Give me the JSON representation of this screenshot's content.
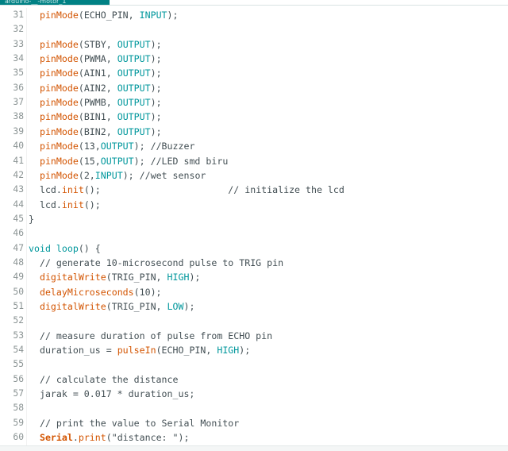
{
  "tab": {
    "label": "arduino-__-motor_1"
  },
  "colors": {
    "accent": "#008184",
    "function": "#d35400",
    "constant": "#00979c",
    "text": "#434f54",
    "line_number": "#8a9393"
  },
  "lines": [
    {
      "n": "31",
      "fold": "",
      "tokens": [
        {
          "t": "  "
        },
        {
          "t": "pinMode",
          "c": "fn"
        },
        {
          "t": "(ECHO_PIN, "
        },
        {
          "t": "INPUT",
          "c": "const"
        },
        {
          "t": ");"
        }
      ]
    },
    {
      "n": "32",
      "fold": "",
      "tokens": []
    },
    {
      "n": "33",
      "fold": "",
      "tokens": [
        {
          "t": "  "
        },
        {
          "t": "pinMode",
          "c": "fn"
        },
        {
          "t": "(STBY, "
        },
        {
          "t": "OUTPUT",
          "c": "const"
        },
        {
          "t": ");"
        }
      ]
    },
    {
      "n": "34",
      "fold": "",
      "tokens": [
        {
          "t": "  "
        },
        {
          "t": "pinMode",
          "c": "fn"
        },
        {
          "t": "(PWMA, "
        },
        {
          "t": "OUTPUT",
          "c": "const"
        },
        {
          "t": ");"
        }
      ]
    },
    {
      "n": "35",
      "fold": "",
      "tokens": [
        {
          "t": "  "
        },
        {
          "t": "pinMode",
          "c": "fn"
        },
        {
          "t": "(AIN1, "
        },
        {
          "t": "OUTPUT",
          "c": "const"
        },
        {
          "t": ");"
        }
      ]
    },
    {
      "n": "36",
      "fold": "",
      "tokens": [
        {
          "t": "  "
        },
        {
          "t": "pinMode",
          "c": "fn"
        },
        {
          "t": "(AIN2, "
        },
        {
          "t": "OUTPUT",
          "c": "const"
        },
        {
          "t": ");"
        }
      ]
    },
    {
      "n": "37",
      "fold": "",
      "tokens": [
        {
          "t": "  "
        },
        {
          "t": "pinMode",
          "c": "fn"
        },
        {
          "t": "(PWMB, "
        },
        {
          "t": "OUTPUT",
          "c": "const"
        },
        {
          "t": ");"
        }
      ]
    },
    {
      "n": "38",
      "fold": "",
      "tokens": [
        {
          "t": "  "
        },
        {
          "t": "pinMode",
          "c": "fn"
        },
        {
          "t": "(BIN1, "
        },
        {
          "t": "OUTPUT",
          "c": "const"
        },
        {
          "t": ");"
        }
      ]
    },
    {
      "n": "39",
      "fold": "",
      "tokens": [
        {
          "t": "  "
        },
        {
          "t": "pinMode",
          "c": "fn"
        },
        {
          "t": "(BIN2, "
        },
        {
          "t": "OUTPUT",
          "c": "const"
        },
        {
          "t": ");"
        }
      ]
    },
    {
      "n": "40",
      "fold": "",
      "tokens": [
        {
          "t": "  "
        },
        {
          "t": "pinMode",
          "c": "fn"
        },
        {
          "t": "(13,"
        },
        {
          "t": "OUTPUT",
          "c": "const"
        },
        {
          "t": "); //Buzzer"
        }
      ]
    },
    {
      "n": "41",
      "fold": "",
      "tokens": [
        {
          "t": "  "
        },
        {
          "t": "pinMode",
          "c": "fn"
        },
        {
          "t": "(15,"
        },
        {
          "t": "OUTPUT",
          "c": "const"
        },
        {
          "t": "); //LED smd biru"
        }
      ]
    },
    {
      "n": "42",
      "fold": "",
      "tokens": [
        {
          "t": "  "
        },
        {
          "t": "pinMode",
          "c": "fn"
        },
        {
          "t": "(2,"
        },
        {
          "t": "INPUT",
          "c": "const"
        },
        {
          "t": "); //wet sensor"
        }
      ]
    },
    {
      "n": "43",
      "fold": "",
      "tokens": [
        {
          "t": "  lcd."
        },
        {
          "t": "init",
          "c": "fn"
        },
        {
          "t": "();                       // initialize the lcd"
        }
      ]
    },
    {
      "n": "44",
      "fold": "",
      "tokens": [
        {
          "t": "  lcd."
        },
        {
          "t": "init",
          "c": "fn"
        },
        {
          "t": "();"
        }
      ]
    },
    {
      "n": "45",
      "fold": "",
      "tokens": [
        {
          "t": "}"
        }
      ]
    },
    {
      "n": "46",
      "fold": "",
      "tokens": []
    },
    {
      "n": "47",
      "fold": "",
      "tokens": [
        {
          "t": "void",
          "c": "kw"
        },
        {
          "t": " "
        },
        {
          "t": "loop",
          "c": "kw"
        },
        {
          "t": "() {"
        }
      ]
    },
    {
      "n": "48",
      "fold": "",
      "tokens": [
        {
          "t": "  // generate 10-microsecond pulse to TRIG pin"
        }
      ]
    },
    {
      "n": "49",
      "fold": "",
      "tokens": [
        {
          "t": "  "
        },
        {
          "t": "digitalWrite",
          "c": "fn"
        },
        {
          "t": "(TRIG_PIN, "
        },
        {
          "t": "HIGH",
          "c": "const"
        },
        {
          "t": ");"
        }
      ]
    },
    {
      "n": "50",
      "fold": "",
      "tokens": [
        {
          "t": "  "
        },
        {
          "t": "delayMicroseconds",
          "c": "fn"
        },
        {
          "t": "(10);"
        }
      ]
    },
    {
      "n": "51",
      "fold": "",
      "tokens": [
        {
          "t": "  "
        },
        {
          "t": "digitalWrite",
          "c": "fn"
        },
        {
          "t": "(TRIG_PIN, "
        },
        {
          "t": "LOW",
          "c": "const"
        },
        {
          "t": ");"
        }
      ]
    },
    {
      "n": "52",
      "fold": "",
      "tokens": []
    },
    {
      "n": "53",
      "fold": "",
      "tokens": [
        {
          "t": "  // measure duration of pulse from ECHO pin"
        }
      ]
    },
    {
      "n": "54",
      "fold": "",
      "tokens": [
        {
          "t": "  duration_us = "
        },
        {
          "t": "pulseIn",
          "c": "fn"
        },
        {
          "t": "(ECHO_PIN, "
        },
        {
          "t": "HIGH",
          "c": "const"
        },
        {
          "t": ");"
        }
      ]
    },
    {
      "n": "55",
      "fold": "",
      "tokens": []
    },
    {
      "n": "56",
      "fold": "",
      "tokens": [
        {
          "t": "  // calculate the distance"
        }
      ]
    },
    {
      "n": "57",
      "fold": "",
      "tokens": [
        {
          "t": "  jarak = 0.017 * duration_us;"
        }
      ]
    },
    {
      "n": "58",
      "fold": "",
      "tokens": []
    },
    {
      "n": "59",
      "fold": "",
      "tokens": [
        {
          "t": "  // print the value to Serial Monitor"
        }
      ]
    },
    {
      "n": "60",
      "fold": "",
      "tokens": [
        {
          "t": "  "
        },
        {
          "t": "Serial",
          "c": "cls"
        },
        {
          "t": "."
        },
        {
          "t": "print",
          "c": "fn"
        },
        {
          "t": "(\"distance: \");"
        }
      ]
    }
  ]
}
